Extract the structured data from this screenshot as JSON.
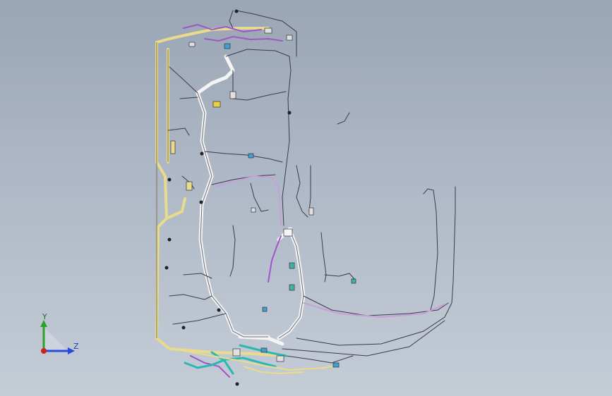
{
  "viewport": {
    "background_top": "#9aa5b5",
    "background_bottom": "#c4ccd6"
  },
  "model": {
    "description_icon": "wiring-harness-3d-model",
    "colors": {
      "yellow_bundle": "#e8dc8c",
      "white_bundle": "#f4f4f4",
      "purple_wire": "#a055c8",
      "teal_wire": "#2cb8b0",
      "dark_wire": "#3a3a4a",
      "pink_wire": "#c8a0d8"
    }
  },
  "triad": {
    "y_label": "Y",
    "z_label": "Z",
    "colors": {
      "y": "#2ea02e",
      "z": "#2b4bd6",
      "x": "#d02020"
    }
  }
}
